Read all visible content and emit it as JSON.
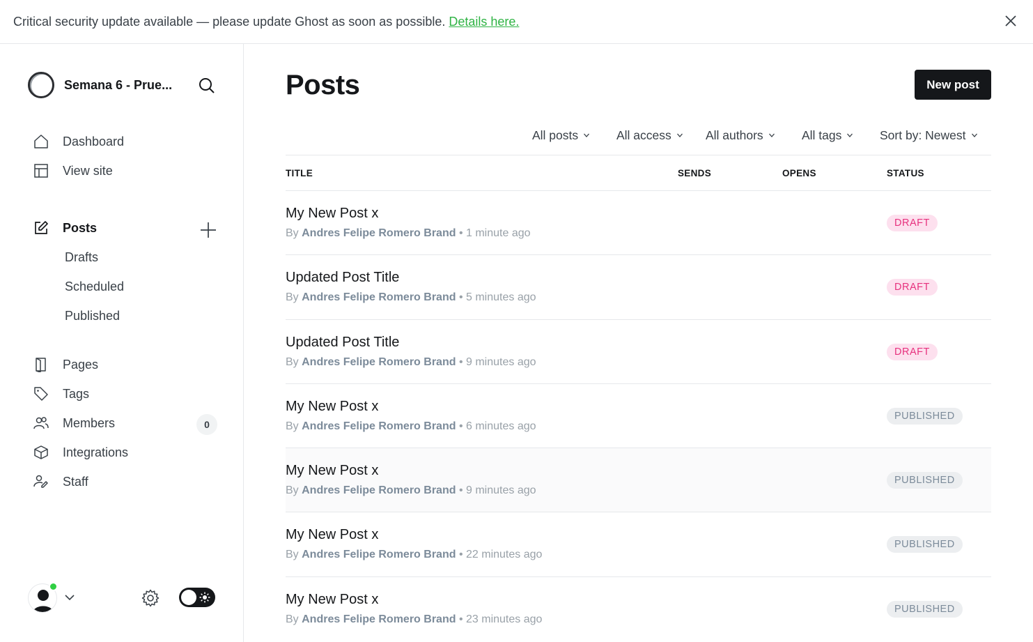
{
  "banner": {
    "message": "Critical security update available — please update Ghost as soon as possible.",
    "link": "Details here."
  },
  "sidebar": {
    "site_name": "Semana 6 - Prue...",
    "nav": [
      {
        "label": "Dashboard",
        "icon": "home-icon"
      },
      {
        "label": "View site",
        "icon": "layout-icon"
      }
    ],
    "posts": {
      "label": "Posts",
      "icon": "edit-icon"
    },
    "post_subitems": [
      "Drafts",
      "Scheduled",
      "Published"
    ],
    "nav2": [
      {
        "label": "Pages",
        "icon": "page-icon"
      },
      {
        "label": "Tags",
        "icon": "tag-icon"
      },
      {
        "label": "Members",
        "icon": "members-icon"
      },
      {
        "label": "Integrations",
        "icon": "cube-icon"
      },
      {
        "label": "Staff",
        "icon": "staff-icon"
      }
    ],
    "members_count": "0"
  },
  "main": {
    "title": "Posts",
    "new_post_label": "New post",
    "filters": [
      "All posts",
      "All access",
      "All authors",
      "All tags",
      "Sort by: Newest"
    ],
    "columns": [
      "TITLE",
      "SENDS",
      "OPENS",
      "STATUS"
    ],
    "posts": [
      {
        "title": "My New Post x",
        "by": "By",
        "author": "Andres Felipe Romero Brand",
        "time": "1 minute ago",
        "status": "DRAFT"
      },
      {
        "title": "Updated Post Title",
        "by": "By",
        "author": "Andres Felipe Romero Brand",
        "time": "5 minutes ago",
        "status": "DRAFT"
      },
      {
        "title": "Updated Post Title",
        "by": "By",
        "author": "Andres Felipe Romero Brand",
        "time": "9 minutes ago",
        "status": "DRAFT"
      },
      {
        "title": "My New Post x",
        "by": "By",
        "author": "Andres Felipe Romero Brand",
        "time": "6 minutes ago",
        "status": "PUBLISHED"
      },
      {
        "title": "My New Post x",
        "by": "By",
        "author": "Andres Felipe Romero Brand",
        "time": "9 minutes ago",
        "status": "PUBLISHED"
      },
      {
        "title": "My New Post x",
        "by": "By",
        "author": "Andres Felipe Romero Brand",
        "time": "22 minutes ago",
        "status": "PUBLISHED"
      },
      {
        "title": "My New Post x",
        "by": "By",
        "author": "Andres Felipe Romero Brand",
        "time": "23 minutes ago",
        "status": "PUBLISHED"
      }
    ]
  },
  "colors": {
    "accent_green": "#30cf43",
    "draft_bg": "#fde0ee",
    "draft_text": "#e7317e",
    "published_bg": "#eceef0",
    "published_text": "#7c8b9a"
  }
}
